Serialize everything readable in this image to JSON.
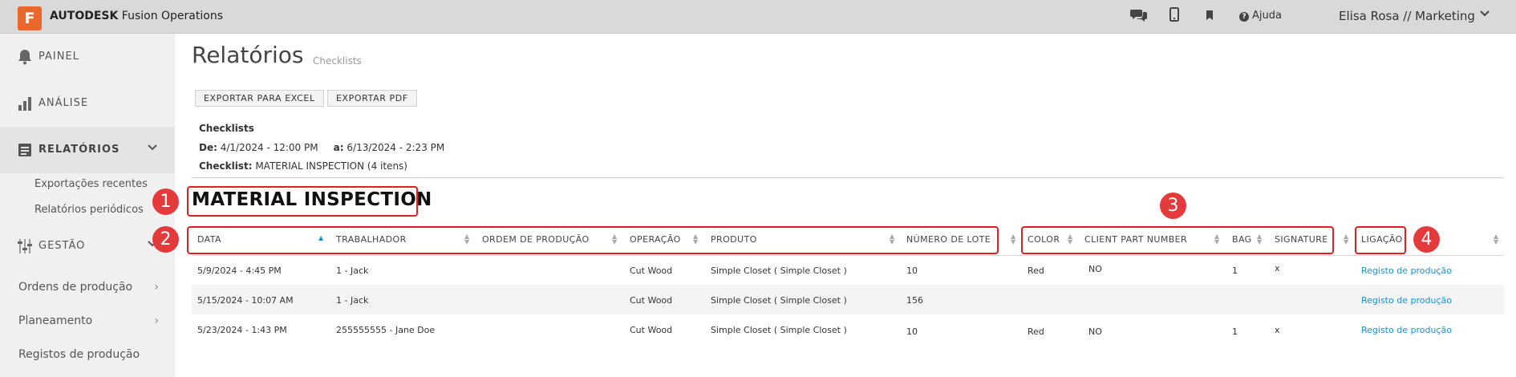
{
  "topbar": {
    "logo_letter": "F",
    "brand_bold": "AUTODESK",
    "brand_rest": "Fusion Operations",
    "help_label": "Ajuda",
    "user_label": "Elisa Rosa // Marketing",
    "icons": [
      "chat-icon",
      "mobile-icon",
      "bookmark-icon",
      "help-icon",
      "chevron-down-icon"
    ]
  },
  "sidebar": {
    "items": [
      {
        "label": "PAINEL",
        "icon": "bell-icon"
      },
      {
        "label": "ANÁLISE",
        "icon": "bar-chart-icon"
      },
      {
        "label": "RELATÓRIOS",
        "icon": "report-icon"
      },
      {
        "label": "GESTÃO",
        "icon": "sliders-icon"
      }
    ],
    "report_subitems": [
      "Exportações recentes",
      "Relatórios periódicos"
    ],
    "gestao_subitems": [
      "Ordens de produção",
      "Planeamento",
      "Registos de produção"
    ]
  },
  "main": {
    "title": "Relatórios",
    "subtitle": "Checklists",
    "buttons": {
      "excel": "EXPORTAR PARA EXCEL",
      "pdf": "EXPORTAR PDF"
    },
    "info": {
      "heading": "Checklists",
      "from_label": "De:",
      "from_value": "4/1/2024 - 12:00 PM",
      "to_label": "a:",
      "to_value": "6/13/2024 - 2:23 PM",
      "checklist_label": "Checklist:",
      "checklist_value": "MATERIAL INSPECTION (4 itens)"
    },
    "report_title": "MATERIAL INSPECTION",
    "columns": [
      "DATA",
      "TRABALHADOR",
      "ORDEM DE PRODUÇÃO",
      "OPERAÇÃO",
      "PRODUTO",
      "NÚMERO DE LOTE",
      "COLOR",
      "CLIENT PART NUMBER",
      "BAG",
      "SIGNATURE",
      "LIGAÇÃO"
    ],
    "rows": [
      {
        "data": "5/9/2024 - 4:45 PM",
        "trabalhador": "1 - Jack",
        "ordem": "",
        "operacao": "Cut Wood",
        "produto": "Simple Closet ( Simple Closet )",
        "lote": "10",
        "color": "Red",
        "client_part": "NO",
        "bag": "1",
        "signature": "x",
        "ligacao": "Registo de produção"
      },
      {
        "data": "5/15/2024 - 10:07 AM",
        "trabalhador": "1 - Jack",
        "ordem": "",
        "operacao": "Cut Wood",
        "produto": "Simple Closet ( Simple Closet )",
        "lote": "156",
        "color": "",
        "client_part": "",
        "bag": "",
        "signature": "",
        "ligacao": "Registo de produção"
      },
      {
        "data": "5/23/2024 - 1:43 PM",
        "trabalhador": "255555555 - Jane Doe",
        "ordem": "",
        "operacao": "Cut Wood",
        "produto": "Simple Closet ( Simple Closet )",
        "lote": "10",
        "color": "Red",
        "client_part": "NO",
        "bag": "1",
        "signature": "x",
        "ligacao": "Registo de produção"
      }
    ]
  },
  "annotations": [
    "1",
    "2",
    "3",
    "4"
  ],
  "colors": {
    "accent": "#1a8fd8",
    "logo": "#e8692b",
    "annotation": "#e02020"
  }
}
